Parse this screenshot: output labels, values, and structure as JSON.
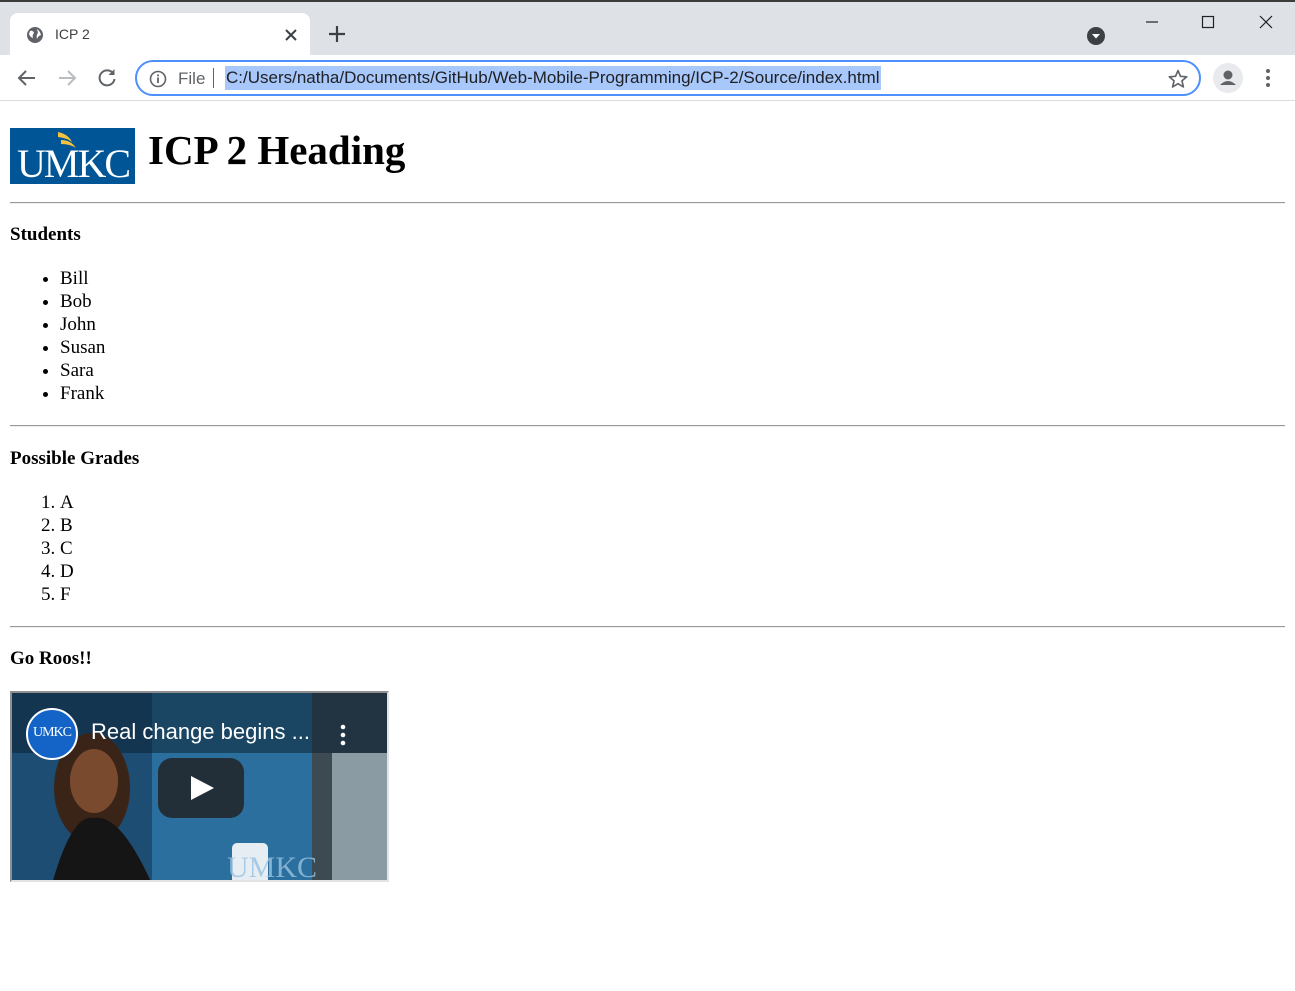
{
  "browser": {
    "tab_title": "ICP 2",
    "address_scheme": "File",
    "url": "C:/Users/natha/Documents/GitHub/Web-Mobile-Programming/ICP-2/Source/index.html",
    "icons": {
      "favicon": "globe-icon",
      "tab_close": "close-icon",
      "new_tab": "plus-icon",
      "tab_search": "chevron-down-icon",
      "back": "back-arrow-icon",
      "forward": "forward-arrow-icon",
      "reload": "reload-icon",
      "site_info": "info-icon",
      "bookmark": "star-icon",
      "profile": "person-icon",
      "menu": "more-vert-icon"
    },
    "colors": {
      "tab_strip": "#dee1e6",
      "focus_ring": "#4d90fe",
      "selection": "#a8c7fa"
    }
  },
  "page": {
    "logo_text": "UMKC",
    "heading": "ICP 2 Heading",
    "students_heading": "Students",
    "students": [
      "Bill",
      "Bob",
      "John",
      "Susan",
      "Sara",
      "Frank"
    ],
    "grades_heading": "Possible Grades",
    "grades": [
      "A",
      "B",
      "C",
      "D",
      "F"
    ],
    "roos_heading": "Go Roos!!",
    "video": {
      "channel": "UMKC",
      "title": "Real change begins ...",
      "icons": {
        "play": "play-icon",
        "more": "more-vert-icon"
      }
    },
    "colors": {
      "logo_blue": "#005596",
      "logo_gold": "#f6c23e"
    }
  }
}
